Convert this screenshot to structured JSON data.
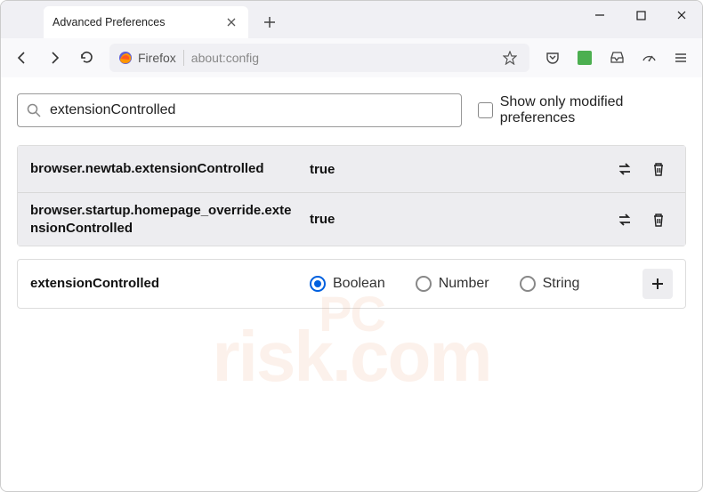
{
  "window": {
    "tab_title": "Advanced Preferences"
  },
  "toolbar": {
    "identity_label": "Firefox",
    "url": "about:config"
  },
  "search": {
    "value": "extensionControlled",
    "checkbox_label": "Show only modified preferences"
  },
  "prefs": [
    {
      "name": "browser.newtab.extensionControlled",
      "value": "true"
    },
    {
      "name": "browser.startup.homepage_override.extensionControlled",
      "value": "true"
    }
  ],
  "add_row": {
    "name": "extensionControlled",
    "types": [
      "Boolean",
      "Number",
      "String"
    ],
    "selected": "Boolean"
  },
  "watermark": {
    "line1": "PC",
    "line2": "risk.com"
  }
}
